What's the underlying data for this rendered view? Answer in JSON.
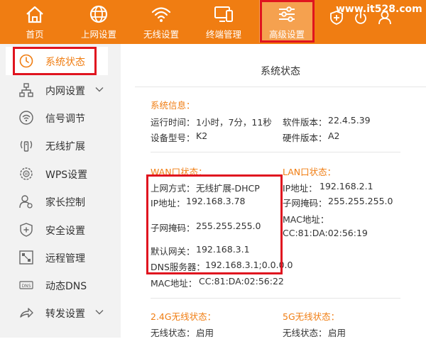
{
  "watermark": "www.it528.com",
  "nav": {
    "home": "首页",
    "internet": "上网设置",
    "wireless": "无线设置",
    "terminal": "终端管理",
    "advanced": "高级设置"
  },
  "sidebar": {
    "items": [
      {
        "label": "系统状态",
        "icon": "clock-icon"
      },
      {
        "label": "内网设置",
        "icon": "network-icon"
      },
      {
        "label": "信号调节",
        "icon": "wifi-signal-icon"
      },
      {
        "label": "无线扩展",
        "icon": "wireless-extend-icon"
      },
      {
        "label": "WPS设置",
        "icon": "wps-icon"
      },
      {
        "label": "家长控制",
        "icon": "parental-icon"
      },
      {
        "label": "安全设置",
        "icon": "shield-icon"
      },
      {
        "label": "远程管理",
        "icon": "remote-icon"
      },
      {
        "label": "动态DNS",
        "icon": "dns-icon"
      },
      {
        "label": "转发设置",
        "icon": "forward-icon"
      }
    ]
  },
  "main": {
    "title": "系统状态",
    "system": {
      "heading": "系统信息：",
      "uptime_label": "运行时间：",
      "uptime_value": "1小时，7分，11秒",
      "software_label": "软件版本：",
      "software_value": "22.4.5.39",
      "model_label": "设备型号：",
      "model_value": "K2",
      "hardware_label": "硬件版本：",
      "hardware_value": "A2"
    },
    "wan": {
      "heading": "WAN口状态：",
      "mode_label": "上网方式：",
      "mode_value": "无线扩展-DHCP",
      "ip_label": "IP地址：",
      "ip_value": "192.168.3.78",
      "mask_label": "子网掩码：",
      "mask_value": "255.255.255.0",
      "gateway_label": "默认网关：",
      "gateway_value": "192.168.3.1",
      "dns_label": "DNS服务器：",
      "dns_value": "192.168.3.1;0.0.0.0",
      "mac_label": "MAC地址：",
      "mac_value": "CC:81:DA:02:56:22"
    },
    "lan": {
      "heading": "LAN口状态：",
      "ip_label": "IP地址：",
      "ip_value": "192.168.2.1",
      "mask_label": "子网掩码：",
      "mask_value": "255.255.255.0",
      "mac_label": "MAC地址：",
      "mac_value": "CC:81:DA:02:56:19"
    },
    "wifi24": {
      "heading": "2.4G无线状态：",
      "status_label": "无线状态：",
      "status_value": "启用"
    },
    "wifi5": {
      "heading": "5G无线状态：",
      "status_label": "无线状态：",
      "status_value": "启用"
    }
  },
  "colors": {
    "brand": "#f07d12",
    "highlight_box": "#e0141f"
  }
}
